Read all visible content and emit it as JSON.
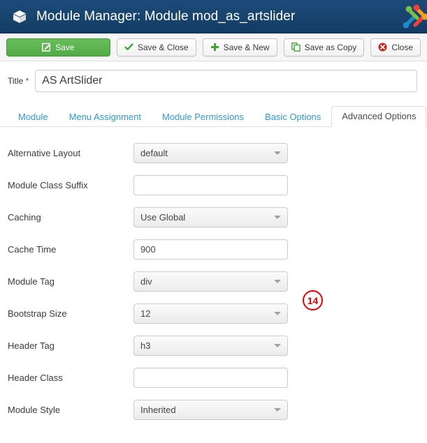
{
  "header": {
    "icon": "cube-icon",
    "title": "Module Manager: Module mod_as_artslider",
    "logo": "joomla-logo",
    "bg_color": "#19456f"
  },
  "toolbar": {
    "buttons": [
      {
        "label": "Save",
        "icon": "pencil-square-icon",
        "style": "primary-green"
      },
      {
        "label": "Save & Close",
        "icon": "checkmark-icon",
        "style": "default"
      },
      {
        "label": "Save & New",
        "icon": "plus-icon",
        "style": "default"
      },
      {
        "label": "Save as Copy",
        "icon": "copy-icon",
        "style": "default"
      },
      {
        "label": "Close",
        "icon": "close-circle-icon",
        "style": "default"
      }
    ]
  },
  "title_field": {
    "label": "Title",
    "required_marker": "*",
    "value": "AS ArtSlider",
    "placeholder": ""
  },
  "tabs": [
    {
      "label": "Module",
      "active": false
    },
    {
      "label": "Menu Assignment",
      "active": false
    },
    {
      "label": "Module Permissions",
      "active": false
    },
    {
      "label": "Basic Options",
      "active": false
    },
    {
      "label": "Advanced Options",
      "active": true
    }
  ],
  "form": {
    "rows": [
      {
        "label": "Alternative Layout",
        "type": "select",
        "value": "default"
      },
      {
        "label": "Module Class Suffix",
        "type": "text",
        "value": ""
      },
      {
        "label": "Caching",
        "type": "select",
        "value": "Use Global"
      },
      {
        "label": "Cache Time",
        "type": "text",
        "value": "900"
      },
      {
        "label": "Module Tag",
        "type": "select",
        "value": "div"
      },
      {
        "label": "Bootstrap Size",
        "type": "select",
        "value": "12"
      },
      {
        "label": "Header Tag",
        "type": "select",
        "value": "h3"
      },
      {
        "label": "Header Class",
        "type": "text",
        "value": ""
      },
      {
        "label": "Module Style",
        "type": "select",
        "value": "Inherited"
      }
    ]
  },
  "annotations": [
    {
      "number": "14",
      "color": "#ee0000",
      "target": "Bootstrap Size"
    }
  ]
}
